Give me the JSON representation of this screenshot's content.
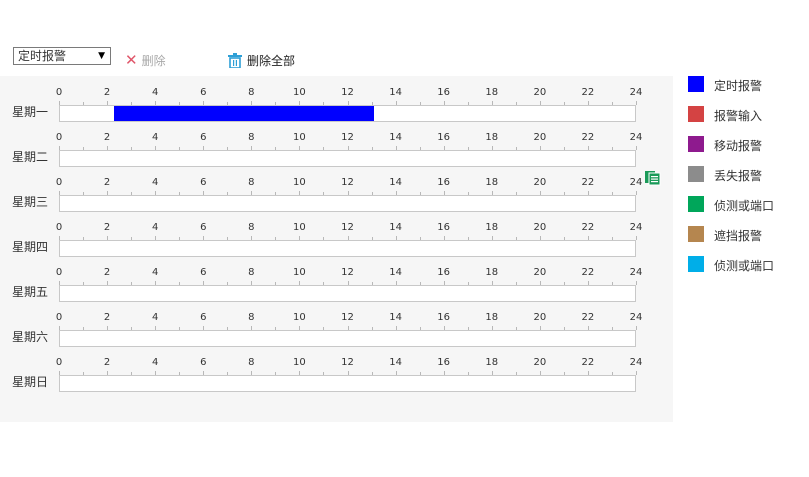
{
  "toolbar": {
    "mode_selected": "定时报警",
    "dropdown_caret": "▼",
    "delete_label": "删除",
    "delete_icon_glyph": "✕",
    "delete_all_label": "删除全部"
  },
  "ticks": [
    "0",
    "2",
    "4",
    "6",
    "8",
    "10",
    "12",
    "14",
    "16",
    "18",
    "20",
    "22",
    "24"
  ],
  "days": [
    {
      "label": "星期一",
      "segments": [
        {
          "start": 2.25,
          "end": 13.1,
          "type": "定时报警"
        }
      ]
    },
    {
      "label": "星期二",
      "segments": []
    },
    {
      "label": "星期三",
      "segments": []
    },
    {
      "label": "星期四",
      "segments": []
    },
    {
      "label": "星期五",
      "segments": []
    },
    {
      "label": "星期六",
      "segments": []
    },
    {
      "label": "星期日",
      "segments": []
    }
  ],
  "legend": [
    {
      "label": "定时报警",
      "color": "#0000ff"
    },
    {
      "label": "报警输入",
      "color": "#d44343"
    },
    {
      "label": "移动报警",
      "color": "#8e1a8e"
    },
    {
      "label": "丢失报警",
      "color": "#8c8c8c"
    },
    {
      "label": "侦测或端口",
      "color": "#00a65a"
    },
    {
      "label": "遮挡报警",
      "color": "#b5864f"
    },
    {
      "label": "侦测或端口",
      "color": "#00aee8"
    }
  ],
  "copy_icon": "copy-schedule-icon",
  "colors": {
    "panel_bg": "#f6f6f6",
    "timeline_border": "#c8c8c8"
  }
}
